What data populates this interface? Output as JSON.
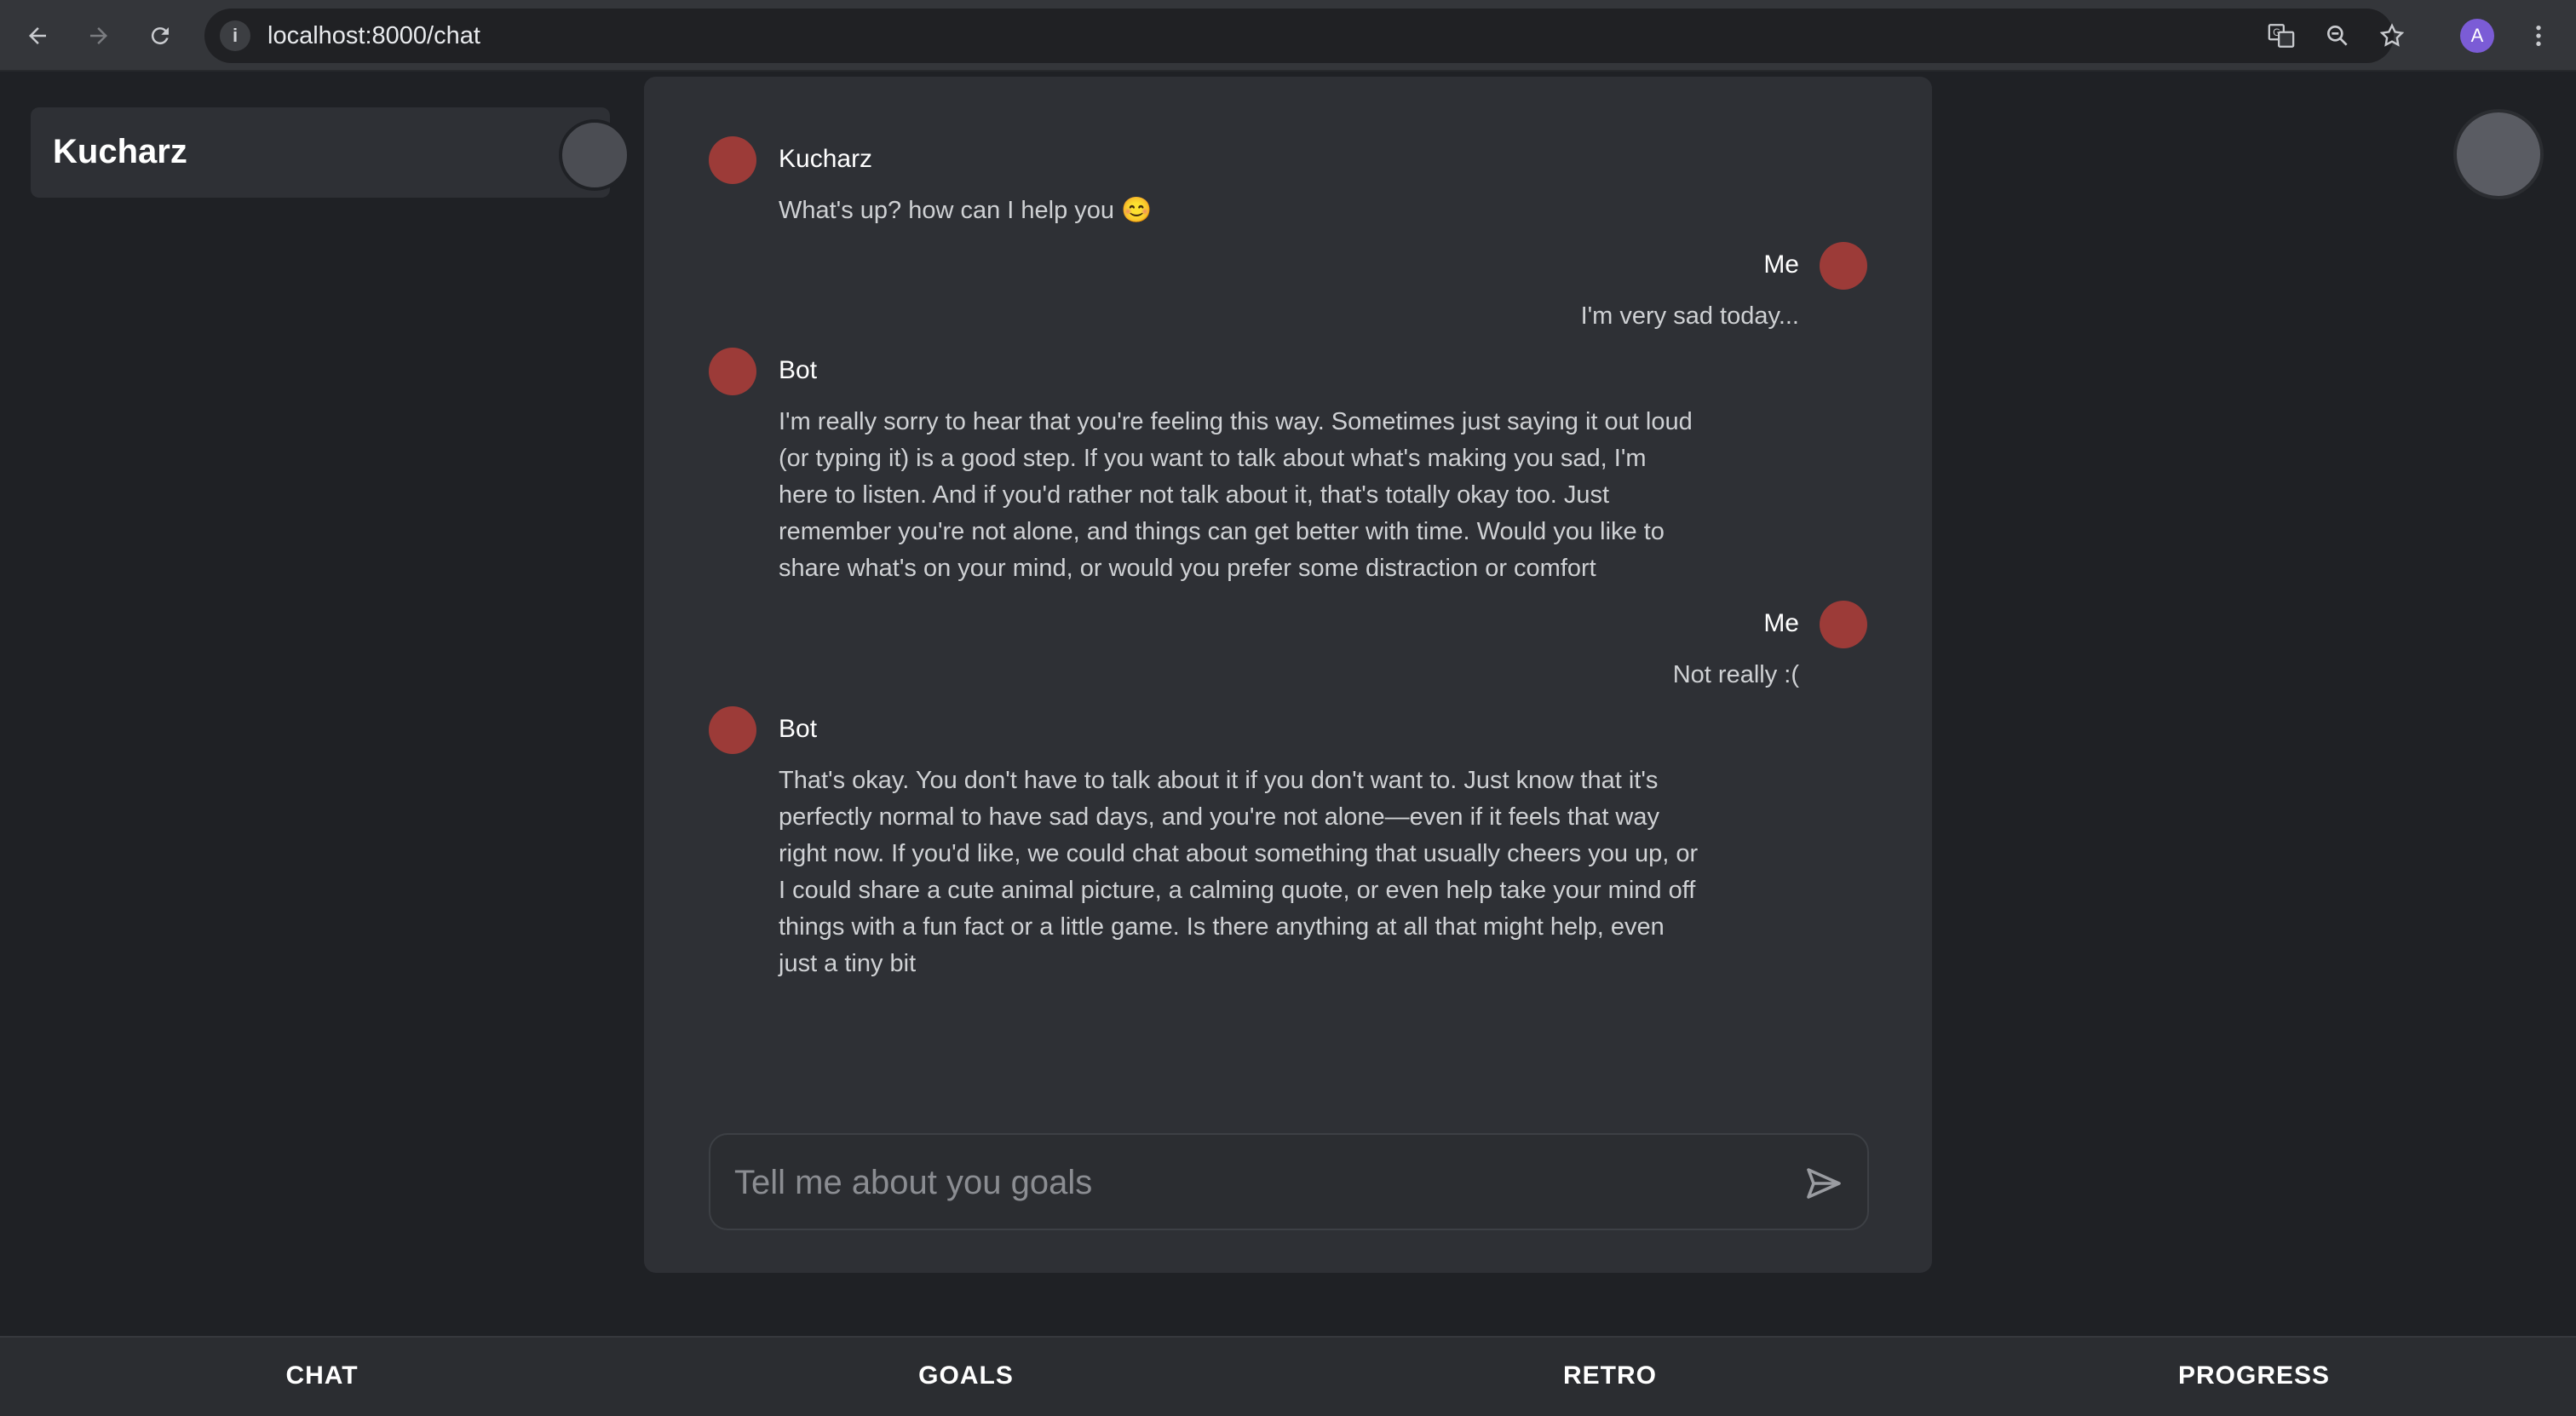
{
  "browser": {
    "url": "localhost:8000/chat",
    "profile_initial": "A"
  },
  "sidebar": {
    "title": "Kucharz"
  },
  "chat": {
    "messages": [
      {
        "sender": "Kucharz",
        "side": "left",
        "text": "What's up? how can I help you 😊"
      },
      {
        "sender": "Me",
        "side": "right",
        "text": "I'm very sad today..."
      },
      {
        "sender": "Bot",
        "side": "left",
        "text": "I'm really sorry to hear that you're feeling this way. Sometimes just saying it out loud (or typing it) is a good step. If you want to talk about what's making you sad, I'm here to listen. And if you'd rather not talk about it, that's totally okay too. Just remember you're not alone, and things can get better with time. Would you like to share what's on your mind, or would you prefer some distraction or comfort"
      },
      {
        "sender": "Me",
        "side": "right",
        "text": "Not really :("
      },
      {
        "sender": "Bot",
        "side": "left",
        "text": "That's okay. You don't have to talk about it if you don't want to. Just know that it's perfectly normal to have sad days, and you're not alone—even if it feels that way right now. If you'd like, we could chat about something that usually cheers you up, or I could share a cute animal picture, a calming quote, or even help take your mind off things with a fun fact or a little game. Is there anything at all that might help, even just a tiny bit"
      }
    ],
    "input": {
      "placeholder": "Tell me about you goals",
      "value": ""
    }
  },
  "bottom_nav": {
    "items": [
      {
        "label": "CHAT"
      },
      {
        "label": "GOALS"
      },
      {
        "label": "RETRO"
      },
      {
        "label": "PROGRESS"
      }
    ]
  },
  "colors": {
    "avatar": "#9c3b38",
    "background": "#1f2125",
    "panel": "#2e3035"
  }
}
